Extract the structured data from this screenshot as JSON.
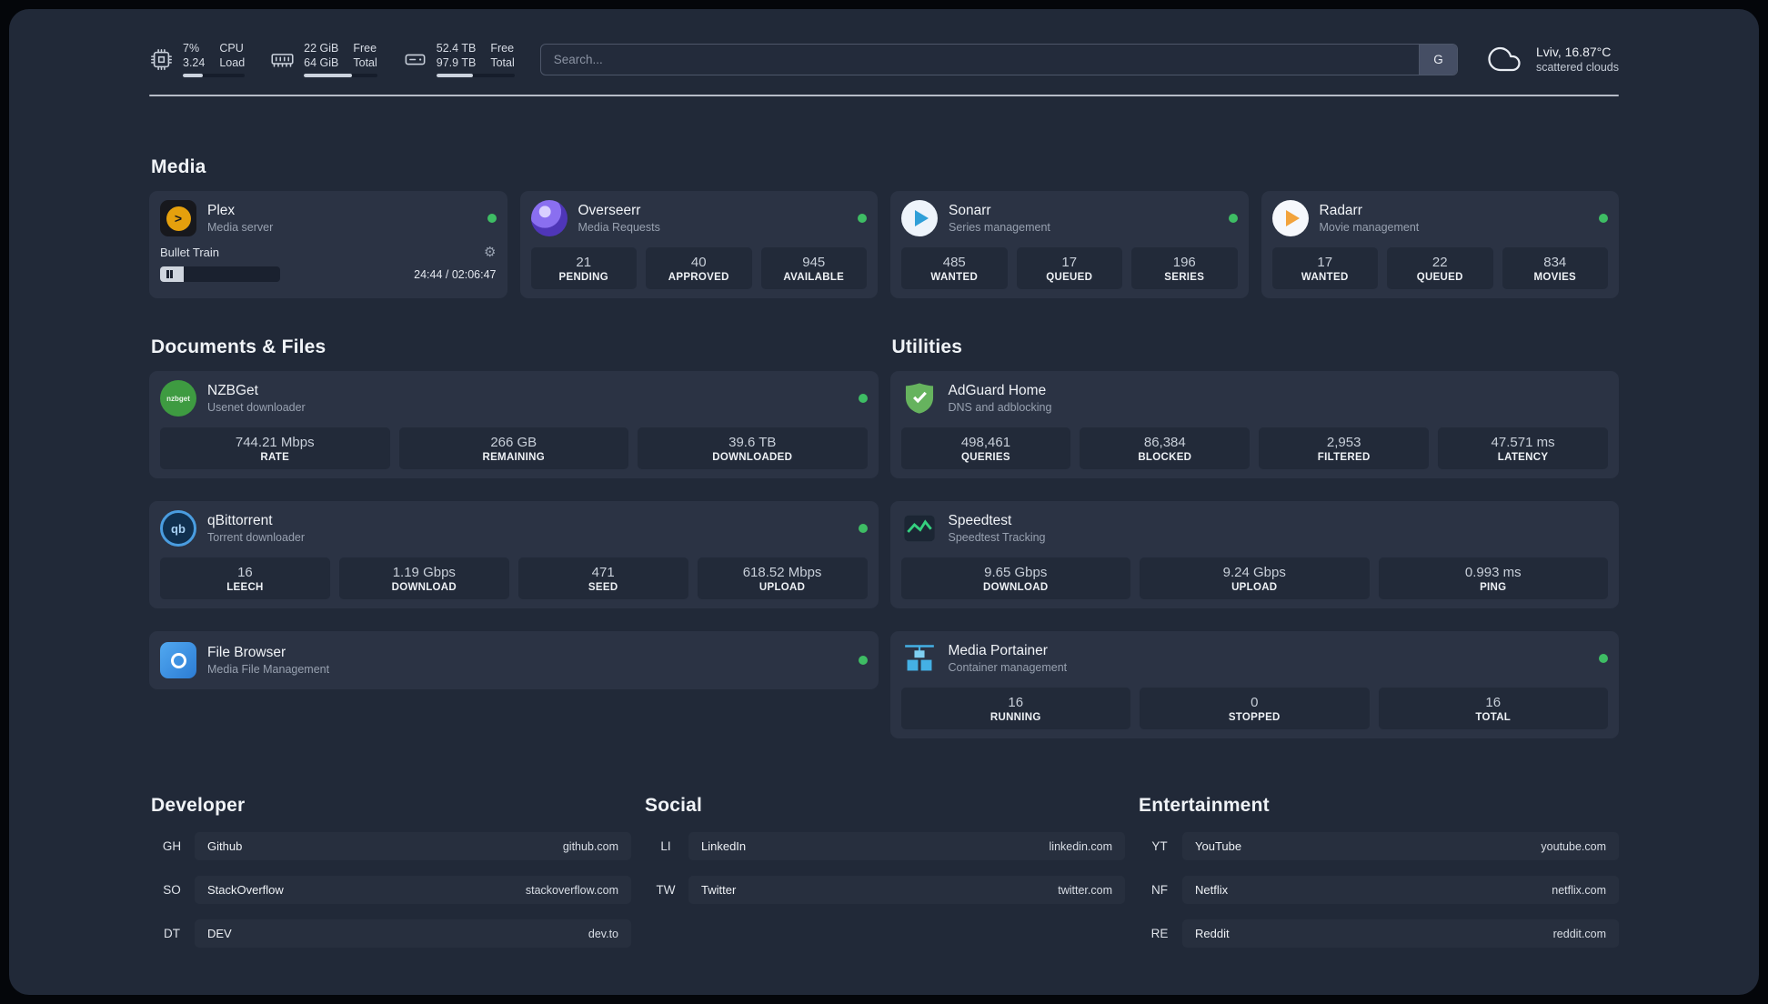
{
  "colors": {
    "status_online": "#3ebd64",
    "background": "#212938",
    "card": "#2b3344"
  },
  "topbar": {
    "cpu": {
      "value_top": "7%",
      "value_bottom": "3.24",
      "label_top": "CPU",
      "label_bottom": "Load",
      "bar_pct": 32
    },
    "ram": {
      "value_top": "22 GiB",
      "value_bottom": "64 GiB",
      "label_top": "Free",
      "label_bottom": "Total",
      "bar_pct": 66
    },
    "disk": {
      "value_top": "52.4 TB",
      "value_bottom": "97.9 TB",
      "label_top": "Free",
      "label_bottom": "Total",
      "bar_pct": 47
    },
    "search": {
      "placeholder": "Search...",
      "button_label": "G"
    },
    "weather": {
      "location": "Lviv, 16.87°C",
      "condition": "scattered clouds"
    }
  },
  "sections": {
    "media": {
      "title": "Media"
    },
    "documents": {
      "title": "Documents & Files"
    },
    "utilities": {
      "title": "Utilities"
    }
  },
  "media_cards": [
    {
      "name": "Plex",
      "subtitle": "Media server",
      "icon": "plex-icon",
      "status": "online",
      "player": {
        "title": "Bullet Train",
        "time": "24:44 / 02:06:47",
        "progress_pct": 20
      }
    },
    {
      "name": "Overseerr",
      "subtitle": "Media Requests",
      "icon": "overseerr-icon",
      "status": "online",
      "stats": [
        {
          "value": "21",
          "label": "PENDING"
        },
        {
          "value": "40",
          "label": "APPROVED"
        },
        {
          "value": "945",
          "label": "AVAILABLE"
        }
      ]
    },
    {
      "name": "Sonarr",
      "subtitle": "Series management",
      "icon": "sonarr-icon",
      "status": "online",
      "stats": [
        {
          "value": "485",
          "label": "WANTED"
        },
        {
          "value": "17",
          "label": "QUEUED"
        },
        {
          "value": "196",
          "label": "SERIES"
        }
      ]
    },
    {
      "name": "Radarr",
      "subtitle": "Movie management",
      "icon": "radarr-icon",
      "status": "online",
      "stats": [
        {
          "value": "17",
          "label": "WANTED"
        },
        {
          "value": "22",
          "label": "QUEUED"
        },
        {
          "value": "834",
          "label": "MOVIES"
        }
      ]
    }
  ],
  "documents_cards": [
    {
      "name": "NZBGet",
      "subtitle": "Usenet downloader",
      "icon": "nzbget-icon",
      "icon_text": "nzbget",
      "status": "online",
      "stats": [
        {
          "value": "744.21 Mbps",
          "label": "RATE"
        },
        {
          "value": "266 GB",
          "label": "REMAINING"
        },
        {
          "value": "39.6 TB",
          "label": "DOWNLOADED"
        }
      ]
    },
    {
      "name": "qBittorrent",
      "subtitle": "Torrent downloader",
      "icon": "qbittorrent-icon",
      "icon_text": "qb",
      "status": "online",
      "stats": [
        {
          "value": "16",
          "label": "LEECH"
        },
        {
          "value": "1.19 Gbps",
          "label": "DOWNLOAD"
        },
        {
          "value": "471",
          "label": "SEED"
        },
        {
          "value": "618.52 Mbps",
          "label": "UPLOAD"
        }
      ]
    },
    {
      "name": "File Browser",
      "subtitle": "Media File Management",
      "icon": "filebrowser-icon",
      "status": "online",
      "stats": []
    }
  ],
  "utilities_cards": [
    {
      "name": "AdGuard Home",
      "subtitle": "DNS and adblocking",
      "icon": "adguard-shield-icon",
      "stats": [
        {
          "value": "498,461",
          "label": "QUERIES"
        },
        {
          "value": "86,384",
          "label": "BLOCKED"
        },
        {
          "value": "2,953",
          "label": "FILTERED"
        },
        {
          "value": "47.571 ms",
          "label": "LATENCY"
        }
      ]
    },
    {
      "name": "Speedtest",
      "subtitle": "Speedtest Tracking",
      "icon": "speedtest-graph-icon",
      "stats": [
        {
          "value": "9.65 Gbps",
          "label": "DOWNLOAD"
        },
        {
          "value": "9.24 Gbps",
          "label": "UPLOAD"
        },
        {
          "value": "0.993 ms",
          "label": "PING"
        }
      ]
    },
    {
      "name": "Media Portainer",
      "subtitle": "Container management",
      "icon": "portainer-icon",
      "status": "online",
      "stats": [
        {
          "value": "16",
          "label": "RUNNING"
        },
        {
          "value": "0",
          "label": "STOPPED"
        },
        {
          "value": "16",
          "label": "TOTAL"
        }
      ]
    }
  ],
  "bookmark_groups": [
    {
      "title": "Developer",
      "items": [
        {
          "abbr": "GH",
          "name": "Github",
          "url": "github.com"
        },
        {
          "abbr": "SO",
          "name": "StackOverflow",
          "url": "stackoverflow.com"
        },
        {
          "abbr": "DT",
          "name": "DEV",
          "url": "dev.to"
        }
      ]
    },
    {
      "title": "Social",
      "items": [
        {
          "abbr": "LI",
          "name": "LinkedIn",
          "url": "linkedin.com"
        },
        {
          "abbr": "TW",
          "name": "Twitter",
          "url": "twitter.com"
        }
      ]
    },
    {
      "title": "Entertainment",
      "items": [
        {
          "abbr": "YT",
          "name": "YouTube",
          "url": "youtube.com"
        },
        {
          "abbr": "NF",
          "name": "Netflix",
          "url": "netflix.com"
        },
        {
          "abbr": "RE",
          "name": "Reddit",
          "url": "reddit.com"
        }
      ]
    }
  ]
}
